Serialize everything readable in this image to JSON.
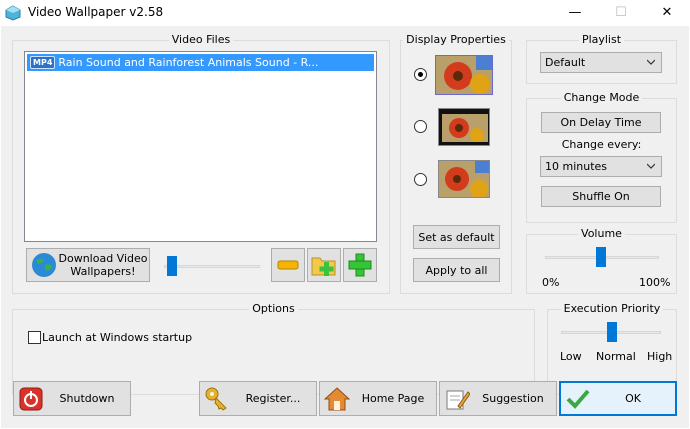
{
  "window": {
    "title": "Video Wallpaper  v2.58",
    "minimize": "—",
    "maximize": "☐",
    "close": "✕"
  },
  "video_files": {
    "title": "Video Files",
    "items": [
      {
        "badge": "MP4",
        "name": "Rain Sound and Rainforest Animals Sound - R..."
      }
    ],
    "download_label": "Download Video Wallpapers!"
  },
  "display_properties": {
    "title": "Display Properties",
    "selected_index": 0,
    "set_default_label": "Set as default",
    "apply_all_label": "Apply to all"
  },
  "playlist": {
    "title": "Playlist",
    "selected": "Default"
  },
  "change_mode": {
    "title": "Change Mode",
    "mode_label": "On Delay Time",
    "change_every_label": "Change every:",
    "interval": "10 minutes",
    "shuffle_label": "Shuffle On"
  },
  "volume": {
    "title": "Volume",
    "min_label": "0%",
    "max_label": "100%",
    "level": 0.5
  },
  "options": {
    "title": "Options",
    "startup_label": "Launch at Windows startup",
    "startup_checked": false
  },
  "execution_priority": {
    "title": "Execution Priority",
    "low": "Low",
    "normal": "Normal",
    "high": "High",
    "level": 0.5
  },
  "bottom": {
    "shutdown": "Shutdown",
    "register": "Register...",
    "home_page": "Home Page",
    "suggestion": "Suggestion",
    "ok": "OK"
  }
}
